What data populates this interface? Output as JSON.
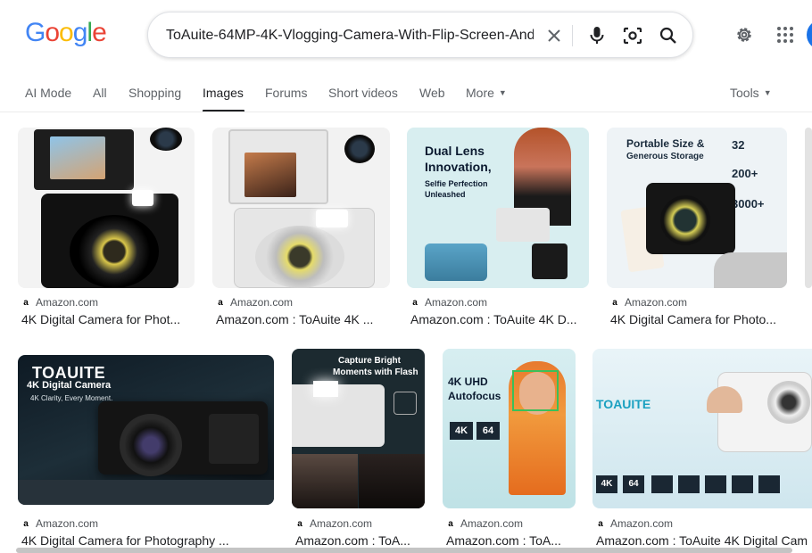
{
  "logo": {
    "letters": [
      "G",
      "o",
      "o",
      "g",
      "l",
      "e"
    ],
    "colors": [
      "#4285F4",
      "#EA4335",
      "#FBBC05",
      "#4285F4",
      "#34A853",
      "#EA4335"
    ]
  },
  "search": {
    "query": "ToAuite-64MP-4K-Vlogging-Camera-With-Flip-Screen-And"
  },
  "icons": {
    "clear": "close-icon",
    "voice": "mic-icon",
    "lens": "camera-lens-icon",
    "search": "search-icon",
    "settings": "gear-icon",
    "apps": "apps-grid-icon"
  },
  "tabs": [
    {
      "label": "AI Mode"
    },
    {
      "label": "All"
    },
    {
      "label": "Shopping"
    },
    {
      "label": "Images"
    },
    {
      "label": "Forums"
    },
    {
      "label": "Short videos"
    },
    {
      "label": "Web"
    },
    {
      "label": "More"
    }
  ],
  "tools": {
    "label": "Tools"
  },
  "results": [
    {
      "source": "Amazon.com",
      "title": "4K Digital Camera for Phot..."
    },
    {
      "source": "Amazon.com",
      "title": "Amazon.com : ToAuite 4K ..."
    },
    {
      "source": "Amazon.com",
      "title": "Amazon.com : ToAuite 4K D..."
    },
    {
      "source": "Amazon.com",
      "title": "4K Digital Camera for Photo..."
    },
    {
      "source": "Amazon.com",
      "title": "4K Digital Camera for Photography ..."
    },
    {
      "source": "Amazon.com",
      "title": "Amazon.com : ToA..."
    },
    {
      "source": "Amazon.com",
      "title": "Amazon.com : ToA..."
    },
    {
      "source": "Amazon.com",
      "title": "Amazon.com : ToAuite 4K Digital Cam"
    }
  ],
  "image_text": {
    "r1c3_line1": "Dual Lens",
    "r1c3_line2": "Innovation,",
    "r1c3_line3": "Selfie Perfection",
    "r1c3_line4": "Unleashed",
    "r1c4_line1": "Portable Size &",
    "r1c4_line2": "Generous Storage",
    "r1c4_badge1": "32",
    "r1c4_badge2": "200+",
    "r1c4_badge3": "3000+",
    "r2c1_brand": "TOAUITE",
    "r2c1_line1": "4K Digital Camera",
    "r2c1_line2": "4K Clarity, Every Moment.",
    "r2c2_line1": "Capture Bright",
    "r2c2_line2": "Moments with Flash",
    "r2c3_line1": "4K UHD",
    "r2c3_line2": "Autofocus",
    "r2c3_b1": "4K",
    "r2c3_b2": "64",
    "r2c4_brand": "TOAUITE",
    "r2c4_b1": "4K",
    "r2c4_b2": "64"
  }
}
